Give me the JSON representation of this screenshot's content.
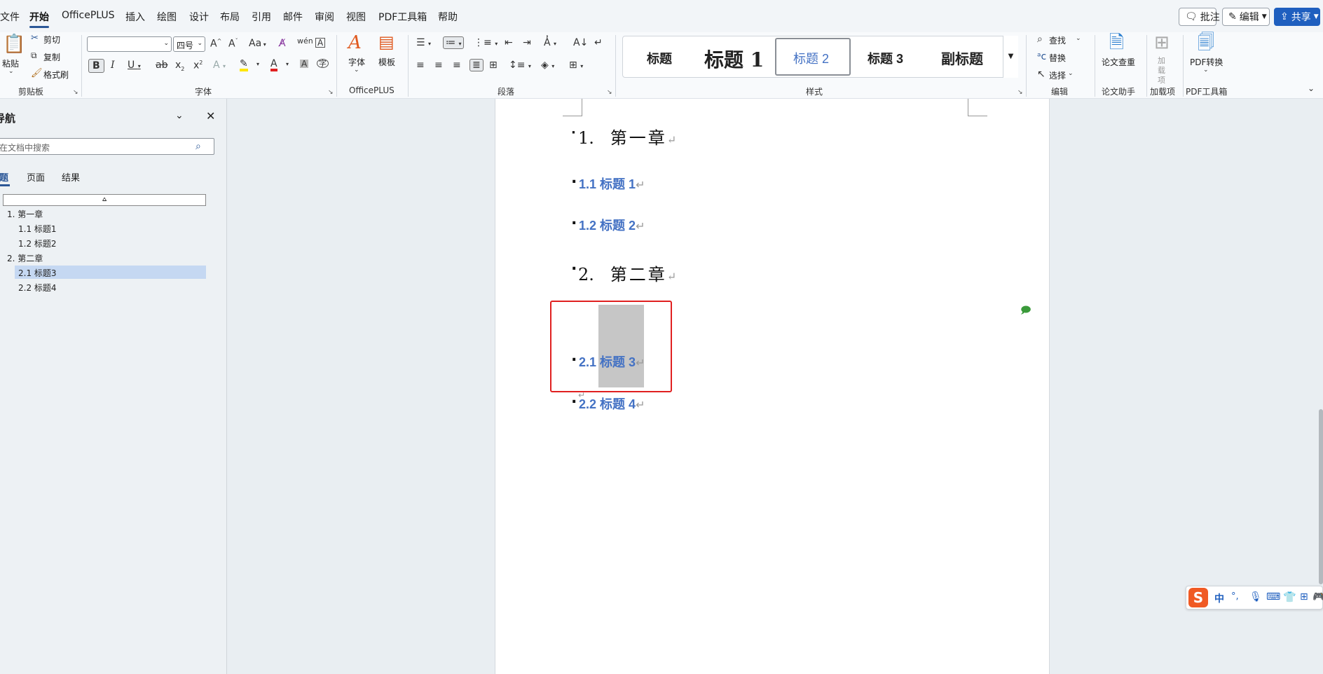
{
  "menu": {
    "tabs": [
      "文件",
      "开始",
      "OfficePLUS",
      "插入",
      "绘图",
      "设计",
      "布局",
      "引用",
      "邮件",
      "审阅",
      "视图",
      "PDF工具箱",
      "帮助"
    ],
    "active_tab": "开始",
    "comment_label": "批注",
    "edit_label": "编辑",
    "share_label": "共享"
  },
  "ribbon": {
    "clipboard": {
      "paste": "粘贴",
      "cut": "剪切",
      "copy": "复制",
      "format_painter": "格式刷",
      "group": "剪贴板"
    },
    "font": {
      "font_name": "",
      "font_size": "四号",
      "group": "字体",
      "change_case": "Aa"
    },
    "officeplus": {
      "fonts": "字体",
      "templates": "模板",
      "group": "OfficePLUS"
    },
    "paragraph": {
      "group": "段落"
    },
    "styles": {
      "items": [
        "标题",
        "标题 1",
        "标题 2",
        "标题 3",
        "副标题"
      ],
      "selected": "标题 2",
      "group": "样式"
    },
    "editing": {
      "find": "查找",
      "replace": "替换",
      "select": "选择",
      "group": "编辑"
    },
    "paper": {
      "check": "论文查重",
      "group": "论文助手"
    },
    "addins": {
      "label": "加载项",
      "group": "加载项"
    },
    "pdf": {
      "convert": "PDF转换",
      "group": "PDF工具箱"
    }
  },
  "nav": {
    "title": "导航",
    "search_placeholder": "在文档中搜索",
    "tabs": [
      "标题",
      "页面",
      "结果"
    ],
    "active_tab": "标题",
    "items": [
      {
        "label": "1. 第一章",
        "level": 1,
        "selected": false
      },
      {
        "label": "1.1 标题1",
        "level": 2,
        "selected": false
      },
      {
        "label": "1.2 标题2",
        "level": 2,
        "selected": false
      },
      {
        "label": "2. 第二章",
        "level": 1,
        "selected": false
      },
      {
        "label": "2.1 标题3",
        "level": 2,
        "selected": true
      },
      {
        "label": "2.2 标题4",
        "level": 2,
        "selected": false
      }
    ]
  },
  "document": {
    "headings": [
      {
        "num": "1.",
        "text": "第一章",
        "level": 1
      },
      {
        "num": "1.1",
        "text": "标题 1",
        "level": 2
      },
      {
        "num": "1.2",
        "text": "标题 2",
        "level": 2
      },
      {
        "num": "2.",
        "text": "第二章",
        "level": 1
      },
      {
        "num": "2.1",
        "text": "标题 3",
        "level": 2
      },
      {
        "num": "2.2",
        "text": "标题 4",
        "level": 2
      }
    ],
    "paragraph_mark": "↵"
  },
  "ime": {
    "lang": "中",
    "punct": "°,"
  },
  "colors": {
    "accent": "#2b5797",
    "heading2": "#4472c4",
    "highlight_box": "#e02020",
    "selection": "#c6c6c6",
    "share": "#1f5fbf"
  }
}
